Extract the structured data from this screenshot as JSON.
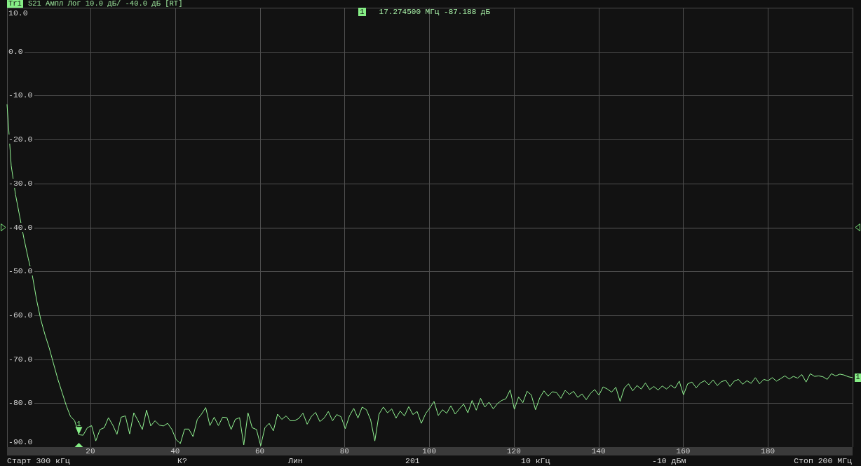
{
  "header": {
    "trace_badge": "Tr1",
    "active": true,
    "trace_settings": "S21 Ампл Лог 10.0 дБ/ -40.0 дБ [RT]"
  },
  "marker_readout": {
    "badge": "1",
    "active": true,
    "value": "17.274500 МГц -87.188 дБ"
  },
  "chart": {
    "trace_tag": "1",
    "chart_data": {
      "type": "line",
      "grid": true,
      "xlim": [
        0.3,
        200
      ],
      "ylim": [
        -90,
        10
      ],
      "xticks": [
        20,
        40,
        60,
        80,
        100,
        120,
        140,
        160,
        180
      ],
      "yticks": [
        {
          "value": 10,
          "label": "10.0"
        },
        {
          "value": 0,
          "label": "0.0"
        },
        {
          "value": -10,
          "label": "-10.0"
        },
        {
          "value": -20,
          "label": "-20.0"
        },
        {
          "value": -30,
          "label": "-30.0"
        },
        {
          "value": -40,
          "label": "-40.0"
        },
        {
          "value": -50,
          "label": "-50.0"
        },
        {
          "value": -60,
          "label": "-60.0"
        },
        {
          "value": -70,
          "label": "-70.0"
        },
        {
          "value": -80,
          "label": "-80.0"
        },
        {
          "value": -90,
          "label": "-90.0"
        }
      ],
      "x": [
        0.3,
        1.2985,
        2.297,
        3.2955,
        4.294,
        5.2925,
        6.291,
        7.2895,
        8.288,
        9.2865,
        10.285,
        11.2835,
        12.282,
        13.2805,
        14.279,
        15.2775,
        16.276,
        17.2745,
        18.273,
        19.2715,
        20.27,
        21.2685,
        22.267,
        23.2655,
        24.264,
        25.2625,
        26.261,
        27.2595,
        28.258,
        29.2565,
        30.255,
        31.2535,
        32.252,
        33.2505,
        34.249,
        35.2475,
        36.246,
        37.2445,
        38.243,
        39.2415,
        40.24,
        41.2385,
        42.237,
        43.2355,
        44.234,
        45.2325,
        46.231,
        47.2295,
        48.228,
        49.2265,
        50.225,
        51.2235,
        52.222,
        53.2205,
        54.219,
        55.2175,
        56.216,
        57.2145,
        58.213,
        59.2115,
        60.21,
        61.2085,
        62.207,
        63.2055,
        64.204,
        65.2025,
        66.201,
        67.1995,
        68.198,
        69.1965,
        70.195,
        71.1935,
        72.192,
        73.1905,
        74.189,
        75.1875,
        76.186,
        77.1845,
        78.183,
        79.1815,
        80.18,
        81.1785,
        82.177,
        83.1755,
        84.174,
        85.1725,
        86.171,
        87.1695,
        88.168,
        89.1665,
        90.165,
        91.1635,
        92.162,
        93.1605,
        94.159,
        95.1575,
        96.156,
        97.1545,
        98.153,
        99.1515,
        100.15,
        101.1485,
        102.147,
        103.1455,
        104.144,
        105.1425,
        106.141,
        107.1395,
        108.138,
        109.1365,
        110.135,
        111.1335,
        112.132,
        113.1305,
        114.129,
        115.1275,
        116.126,
        117.1245,
        118.123,
        119.1215,
        120.12,
        121.1185,
        122.117,
        123.1155,
        124.114,
        125.1125,
        126.111,
        127.1095,
        128.108,
        129.1065,
        130.105,
        131.1035,
        132.102,
        133.1005,
        134.099,
        135.0975,
        136.096,
        137.0945,
        138.093,
        139.0915,
        140.09,
        141.0885,
        142.087,
        143.0855,
        144.084,
        145.0825,
        146.081,
        147.0795,
        148.078,
        149.0765,
        150.075,
        151.0735,
        152.072,
        153.0705,
        154.069,
        155.0675,
        156.066,
        157.0645,
        158.063,
        159.0615,
        160.06,
        161.0585,
        162.057,
        163.0555,
        164.054,
        165.0525,
        166.051,
        167.0495,
        168.048,
        169.0465,
        170.045,
        171.0435,
        172.042,
        173.0405,
        174.039,
        175.0375,
        176.036,
        177.0345,
        178.033,
        179.0315,
        180.03,
        181.0285,
        182.027,
        183.0255,
        184.024,
        185.0225,
        186.021,
        187.0195,
        188.018,
        189.0165,
        190.015,
        191.0135,
        192.012,
        193.0105,
        194.009,
        195.0075,
        196.006,
        197.0045,
        198.003,
        199.0015,
        200
      ],
      "values": [
        -12.0,
        -26.0,
        -32.5,
        -37.5,
        -42.5,
        -47.0,
        -51.0,
        -56.5,
        -61.0,
        -64.5,
        -67.5,
        -71.0,
        -74.5,
        -77.5,
        -80.5,
        -83.0,
        -84.0,
        -87.2,
        -87.3,
        -85.6,
        -85.1,
        -88.6,
        -86.0,
        -85.6,
        -83.3,
        -85.0,
        -87.1,
        -83.2,
        -82.9,
        -87.0,
        -82.2,
        -84.0,
        -86.0,
        -81.6,
        -85.2,
        -84.0,
        -85.0,
        -85.2,
        -84.6,
        -86.0,
        -88.3,
        -89.2,
        -85.9,
        -85.9,
        -87.6,
        -83.7,
        -82.5,
        -81.0,
        -85.1,
        -83.2,
        -85.1,
        -83.2,
        -83.3,
        -86.0,
        -83.7,
        -83.3,
        -89.5,
        -82.2,
        -85.6,
        -86.0,
        -89.7,
        -85.6,
        -84.6,
        -86.3,
        -82.5,
        -83.7,
        -82.9,
        -84.0,
        -84.0,
        -83.5,
        -82.3,
        -84.8,
        -83.0,
        -82.1,
        -84.2,
        -83.4,
        -81.9,
        -84.0,
        -82.6,
        -83.1,
        -85.8,
        -82.9,
        -81.2,
        -83.4,
        -80.9,
        -81.5,
        -83.8,
        -88.6,
        -82.5,
        -80.9,
        -82.2,
        -81.3,
        -83.4,
        -81.8,
        -82.9,
        -80.8,
        -82.6,
        -81.9,
        -84.6,
        -82.4,
        -81.1,
        -79.6,
        -82.8,
        -81.5,
        -82.3,
        -80.6,
        -82.5,
        -81.3,
        -80.2,
        -82.2,
        -79.4,
        -81.6,
        -78.9,
        -80.9,
        -79.8,
        -81.3,
        -80.1,
        -79.4,
        -79.0,
        -77.0,
        -81.4,
        -78.6,
        -79.9,
        -77.3,
        -78.1,
        -81.5,
        -78.8,
        -77.2,
        -78.4,
        -77.4,
        -77.6,
        -78.9,
        -77.1,
        -78.0,
        -77.3,
        -78.7,
        -77.9,
        -79.2,
        -77.8,
        -76.9,
        -78.2,
        -76.3,
        -76.8,
        -77.5,
        -76.4,
        -79.6,
        -76.6,
        -75.6,
        -77.2,
        -76.0,
        -76.8,
        -75.4,
        -76.9,
        -76.2,
        -77.0,
        -76.1,
        -76.8,
        -75.9,
        -76.6,
        -75.0,
        -78.1,
        -75.6,
        -75.2,
        -76.5,
        -75.4,
        -74.9,
        -75.8,
        -74.7,
        -76.0,
        -75.1,
        -74.8,
        -76.2,
        -75.0,
        -74.6,
        -75.7,
        -74.9,
        -75.5,
        -74.2,
        -75.6,
        -74.6,
        -74.9,
        -74.2,
        -75.0,
        -74.4,
        -73.8,
        -74.5,
        -73.9,
        -74.3,
        -73.5,
        -75.2,
        -73.3,
        -73.9,
        -73.8,
        -74.0,
        -74.6,
        -73.3,
        -73.8,
        -73.4,
        -73.6,
        -74.0,
        -74.2
      ],
      "ref_lines": [
        {
          "axis": "y",
          "value": -40
        }
      ],
      "annotations": [
        {
          "x": 17.2745,
          "y": -87.188,
          "text": "1"
        }
      ]
    }
  },
  "status_bar": [
    "Старт 300 кГц",
    "К?",
    "Лин",
    "201",
    "10 кГц",
    "-10 дБм",
    "Стоп 200 МГц"
  ]
}
